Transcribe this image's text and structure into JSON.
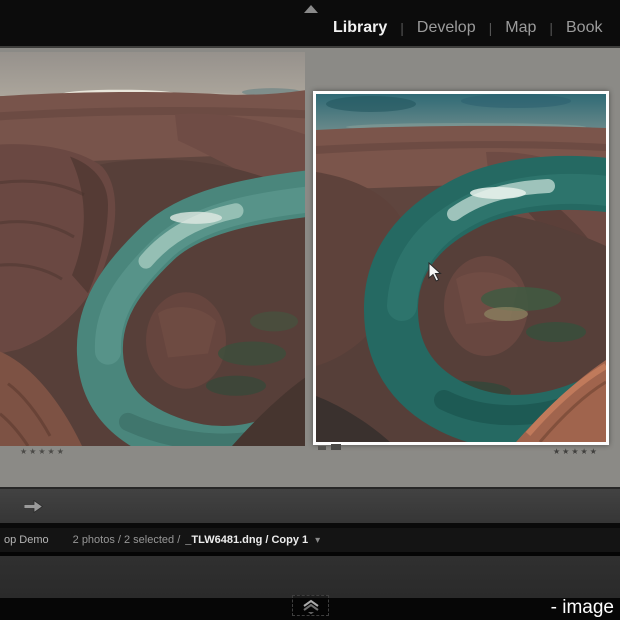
{
  "nav": {
    "separator": "|",
    "items": [
      {
        "label": "Library",
        "active": true
      },
      {
        "label": "Develop",
        "active": false
      },
      {
        "label": "Map",
        "active": false
      },
      {
        "label": "Book",
        "active": false
      }
    ]
  },
  "compare": {
    "left_photo": {
      "description": "Horseshoe Bend canyon photo, unselected, cropped at left edge",
      "stars": "★★★★★"
    },
    "right_photo": {
      "description": "Horseshoe Bend canyon photo, selected with white frame",
      "stars": "★★★★★",
      "selected": true
    }
  },
  "toolbar": {
    "arrow_icon_name": "arrow-right-icon"
  },
  "status_bar": {
    "catalog_label": "op Demo",
    "selection_info": "2 photos / 2 selected /",
    "filename": "_TLW6481.dng / Copy 1",
    "dropdown_arrow": "▾"
  },
  "footer": {
    "caption": "- image"
  },
  "icons": {
    "top_panel_toggle": "triangle-up-icon",
    "filmstrip_toggle": "double-chevron-up-icon",
    "mouse_cursor": "arrow-pointer-icon"
  },
  "colors": {
    "top_bar": "#0c0c0c",
    "workspace_background": "#8b8a86",
    "toolbar": "#3c3c3c",
    "status_bar": "#141414",
    "filmstrip": "#2b2b2b",
    "selection_frame": "#fdfdfd",
    "river_teal": "#4a867c",
    "rock_red": "#6e4b44"
  }
}
